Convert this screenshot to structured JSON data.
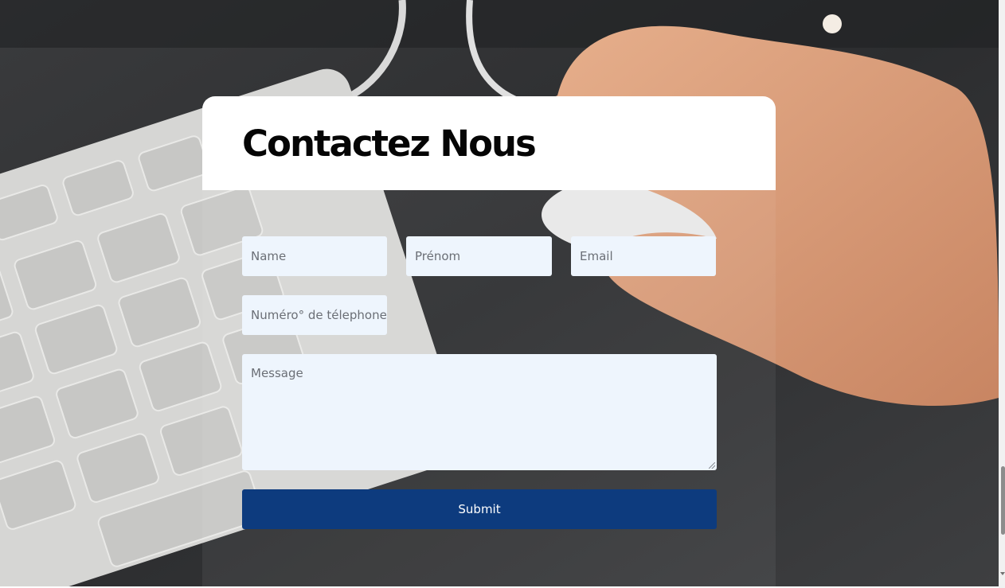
{
  "hero": {
    "background_image": "desk-keyboard-hand-on-mouse-photo"
  },
  "contact": {
    "title": "Contactez Nous"
  },
  "form": {
    "name_placeholder": "Name",
    "prenom_placeholder": "Prénom",
    "email_placeholder": "Email",
    "phone_placeholder": "Numéro° de télephone",
    "message_placeholder": "Message",
    "submit_label": "Submit"
  },
  "colors": {
    "input_bg": "#eef5fd",
    "submit_bg": "#0d3b7e",
    "title_color": "#050505"
  }
}
